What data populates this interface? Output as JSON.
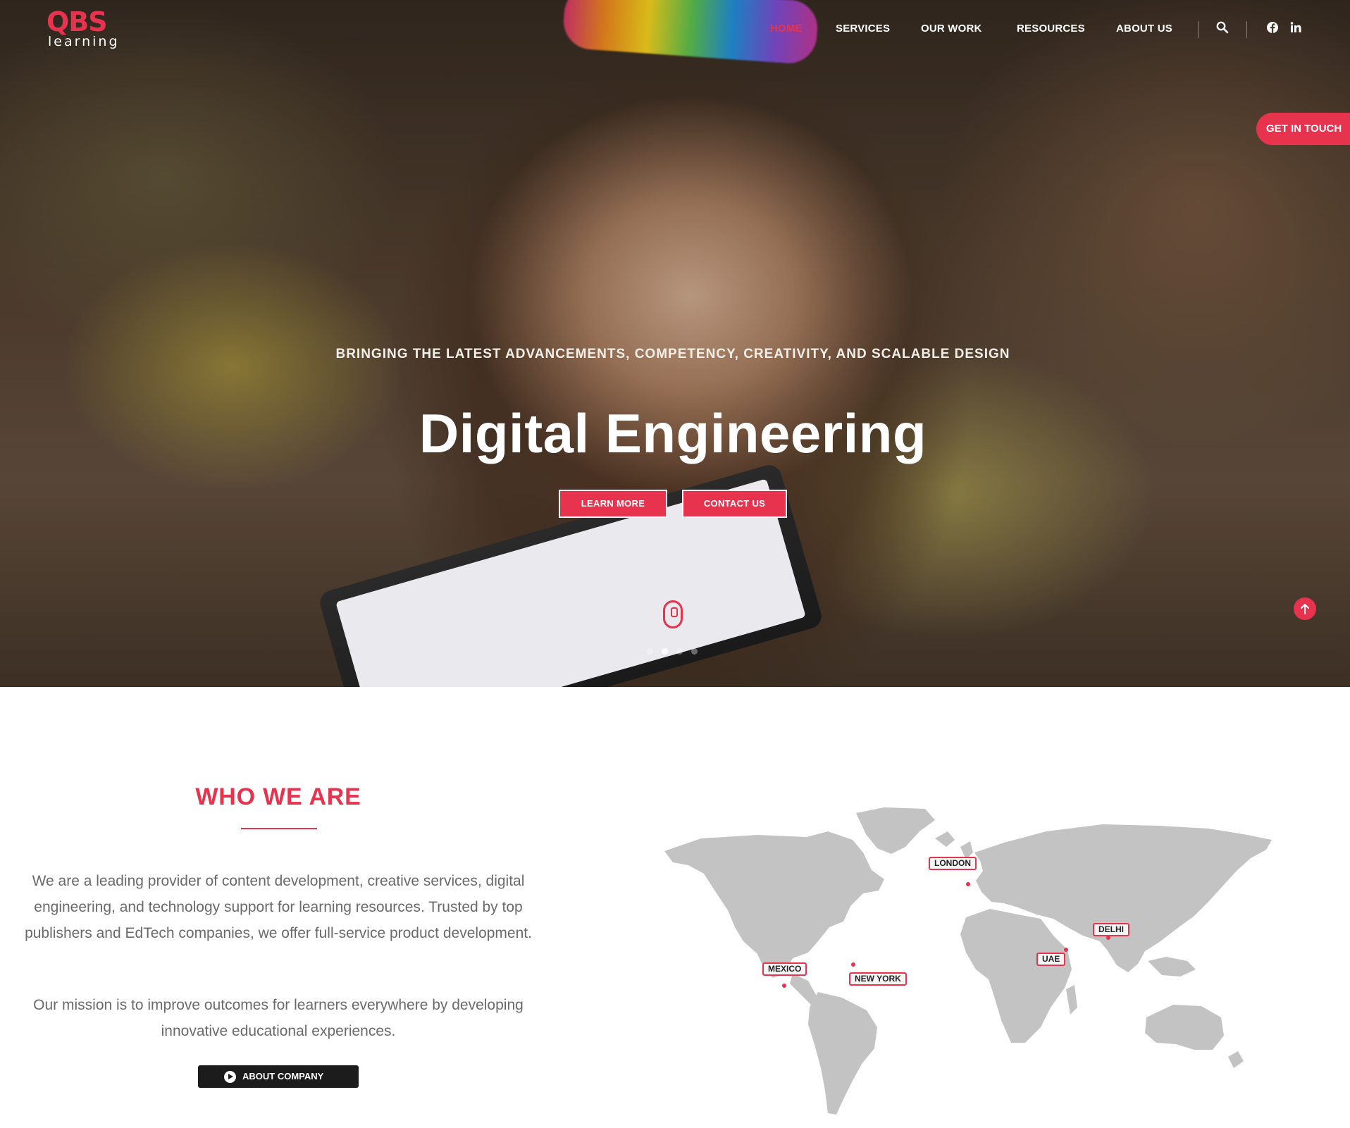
{
  "brand": {
    "logo_main": "QBS",
    "logo_sub": "learning",
    "accent": "#e8334f"
  },
  "nav": {
    "items": [
      "HOME",
      "SERVICES",
      "OUR WORK",
      "RESOURCES",
      "ABOUT US"
    ],
    "active": "HOME",
    "icons": [
      "search-icon",
      "facebook-icon",
      "linkedin-icon"
    ]
  },
  "side_cta": "GET IN TOUCH",
  "hero": {
    "subtitle": "BRINGING THE LATEST ADVANCEMENTS, COMPETENCY, CREATIVITY, AND SCALABLE DESIGN",
    "title": "Digital Engineering",
    "buttons": [
      "LEARN MORE",
      "CONTACT US"
    ],
    "slides": 4,
    "active_slide": 2
  },
  "who": {
    "title": "WHO WE ARE",
    "paragraph1": "We are a leading provider of content development, creative services, digital engineering, and technology support for learning resources. Trusted by top publishers and EdTech companies, we offer full-service product development.",
    "paragraph2": "Our mission is to improve outcomes for learners everywhere by developing innovative educational experiences.",
    "button": "ABOUT COMPANY"
  },
  "map": {
    "locations": [
      "LONDON",
      "NEW YORK",
      "MEXICO",
      "DELHI",
      "UAE"
    ]
  }
}
